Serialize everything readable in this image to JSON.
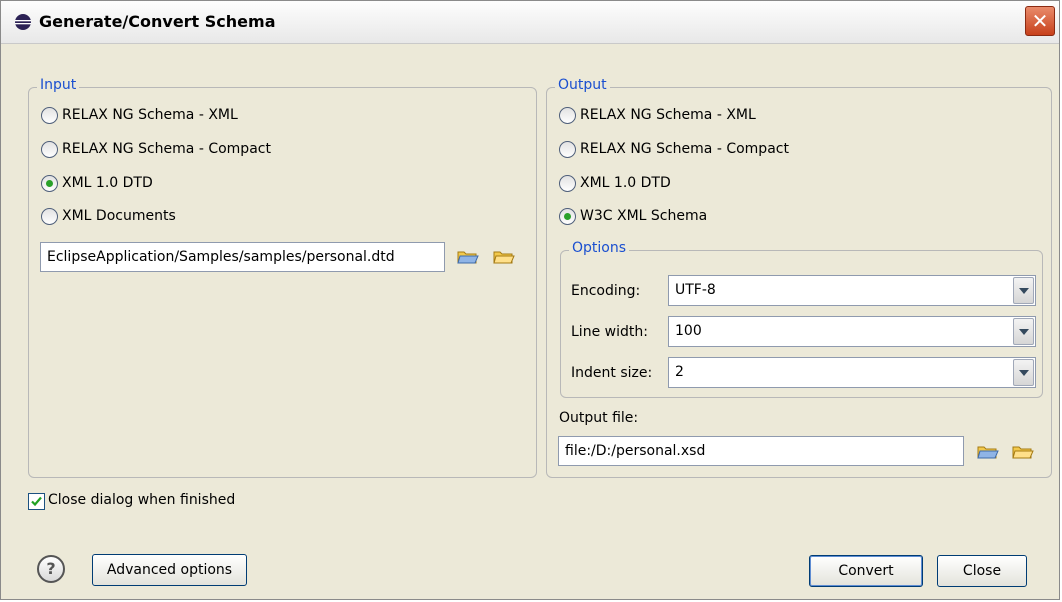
{
  "window": {
    "title": "Generate/Convert Schema"
  },
  "input": {
    "legend": "Input",
    "options": [
      {
        "label": "RELAX NG Schema - XML",
        "checked": false
      },
      {
        "label": "RELAX NG Schema - Compact",
        "checked": false
      },
      {
        "label": "XML 1.0 DTD",
        "checked": true
      },
      {
        "label": "XML Documents",
        "checked": false
      }
    ],
    "path": "EclipseApplication/Samples/samples/personal.dtd"
  },
  "output": {
    "legend": "Output",
    "options": [
      {
        "label": "RELAX NG Schema - XML",
        "checked": false
      },
      {
        "label": "RELAX NG Schema - Compact",
        "checked": false
      },
      {
        "label": "XML 1.0 DTD",
        "checked": false
      },
      {
        "label": "W3C XML Schema",
        "checked": true
      }
    ],
    "options_group": {
      "legend": "Options",
      "encoding_label": "Encoding:",
      "encoding_value": "UTF-8",
      "line_width_label": "Line width:",
      "line_width_value": "100",
      "indent_label": "Indent size:",
      "indent_value": "2"
    },
    "file_label": "Output file:",
    "file_value": "file:/D:/personal.xsd"
  },
  "close_when_finished": {
    "label": "Close dialog when finished",
    "checked": true
  },
  "buttons": {
    "help_glyph": "?",
    "advanced": "Advanced options",
    "convert": "Convert",
    "close": "Close"
  },
  "icons": {
    "title": "eclipse-icon",
    "close": "close-icon",
    "browse_file": "open-folder-icon",
    "browse_folder": "folder-icon"
  }
}
